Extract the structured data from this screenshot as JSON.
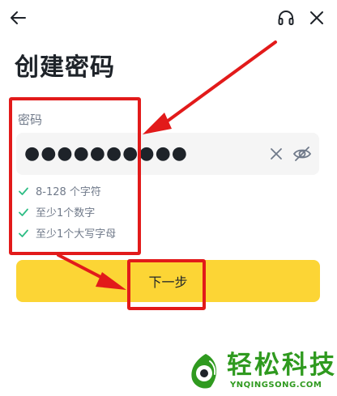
{
  "header": {
    "back_icon": "arrow-left-icon",
    "support_icon": "headset-icon",
    "close_icon": "close-icon"
  },
  "page": {
    "title": "创建密码"
  },
  "password": {
    "label": "密码",
    "value": "●●●●●●●●●●",
    "clear_icon": "clear-x-icon",
    "visibility_icon": "eye-slash-icon"
  },
  "requirements": [
    {
      "text": "8-128 个字符",
      "met": true
    },
    {
      "text": "至少1个数字",
      "met": true
    },
    {
      "text": "至少1个大写字母",
      "met": true
    }
  ],
  "actions": {
    "next_label": "下一步"
  },
  "colors": {
    "primary_button": "#fcd535",
    "check": "#2ebd85",
    "annotation": "#e21a1a",
    "watermark": "#2f9a1f"
  },
  "watermark": {
    "text": "轻松科技",
    "subtext": "YNQINGSONG.COM"
  }
}
